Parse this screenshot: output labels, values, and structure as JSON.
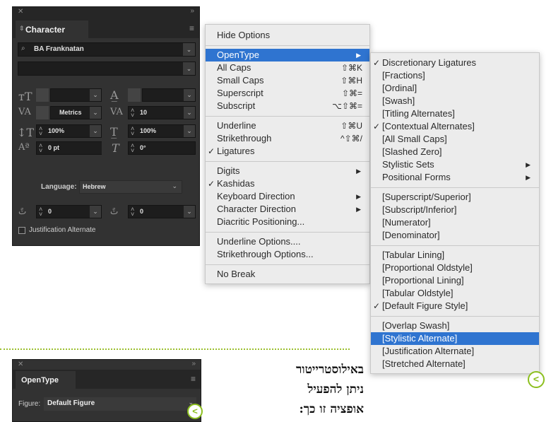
{
  "character_panel": {
    "title": "Character",
    "font_family": "BA Franknatan",
    "font_style": "",
    "kerning": "Metrics",
    "tracking": "10",
    "vertical_scale": "100%",
    "horizontal_scale": "100%",
    "baseline_shift": "0 pt",
    "skew": "0°",
    "language_label": "Language:",
    "language": "Hebrew",
    "diacritic_x": "0",
    "diacritic_y": "0",
    "justification_alternate": "Justification Alternate"
  },
  "main_menu": {
    "items": [
      {
        "label": "Hide Options"
      },
      {
        "label": "OpenType",
        "submenu": true,
        "highlighted": true
      },
      {
        "label": "All Caps",
        "shortcut": "⇧⌘K"
      },
      {
        "label": "Small Caps",
        "shortcut": "⇧⌘H"
      },
      {
        "label": "Superscript",
        "shortcut": "⇧⌘="
      },
      {
        "label": "Subscript",
        "shortcut": "⌥⇧⌘="
      },
      {
        "label": "Underline",
        "shortcut": "⇧⌘U"
      },
      {
        "label": "Strikethrough",
        "shortcut": "^⇧⌘/"
      },
      {
        "label": "Ligatures",
        "checked": true
      },
      {
        "label": "Digits",
        "submenu": true
      },
      {
        "label": "Kashidas",
        "checked": true
      },
      {
        "label": "Keyboard Direction",
        "submenu": true
      },
      {
        "label": "Character Direction",
        "submenu": true
      },
      {
        "label": "Diacritic Positioning..."
      },
      {
        "label": "Underline Options...."
      },
      {
        "label": "Strikethrough Options..."
      },
      {
        "label": "No Break"
      }
    ]
  },
  "opentype_submenu": {
    "items": [
      {
        "label": "Discretionary Ligatures",
        "checked": true
      },
      {
        "label": "[Fractions]"
      },
      {
        "label": "[Ordinal]"
      },
      {
        "label": "[Swash]"
      },
      {
        "label": "[Titling Alternates]"
      },
      {
        "label": "[Contextual Alternates]",
        "checked": true
      },
      {
        "label": "[All Small Caps]"
      },
      {
        "label": "[Slashed Zero]"
      },
      {
        "label": "Stylistic Sets",
        "submenu": true
      },
      {
        "label": "Positional Forms",
        "submenu": true
      },
      {
        "label": "[Superscript/Superior]"
      },
      {
        "label": "[Subscript/Inferior]"
      },
      {
        "label": "[Numerator]"
      },
      {
        "label": "[Denominator]"
      },
      {
        "label": "[Tabular Lining]"
      },
      {
        "label": "[Proportional Oldstyle]"
      },
      {
        "label": "[Proportional Lining]"
      },
      {
        "label": "[Tabular Oldstyle]"
      },
      {
        "label": "[Default Figure Style]",
        "checked": true
      },
      {
        "label": "[Overlap Swash]"
      },
      {
        "label": "[Stylistic Alternate]",
        "highlighted": true
      },
      {
        "label": "[Justification Alternate]"
      },
      {
        "label": "[Stretched Alternate]"
      }
    ]
  },
  "opentype_panel": {
    "title": "OpenType",
    "figure_label": "Figure:",
    "figure_value": "Default Figure"
  },
  "caption": {
    "line1": "באילוסטרייטור",
    "line2": "ניתן להפעיל",
    "line3": "אופציה זו כך:"
  },
  "colors": {
    "accent_green": "#8cbf1f",
    "highlight_blue": "#2f74d0",
    "panel_dark": "#323232"
  }
}
